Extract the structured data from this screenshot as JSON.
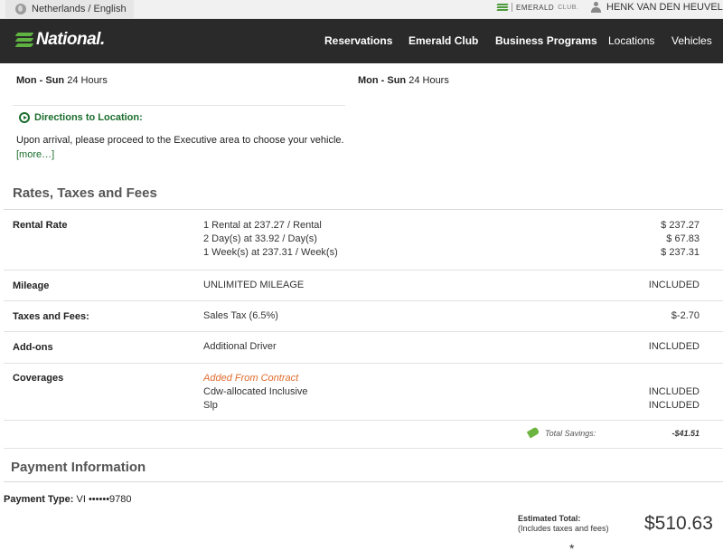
{
  "util_bar": {
    "locale": "Netherlands / English",
    "emerald_brand": "EMERALD",
    "emerald_club": "CLUB.",
    "user_name": "HENK VAN DEN HEUVEL"
  },
  "nav": {
    "logo": "National.",
    "items": [
      "Reservations",
      "Emerald Club",
      "Business Programs",
      "Locations",
      "Vehicles"
    ]
  },
  "hours": [
    {
      "days": "Mon - Sun",
      "time": " 24 Hours"
    },
    {
      "days": "Mon - Sun",
      "time": " 24 Hours"
    }
  ],
  "directions": {
    "title": "Directions to Location:",
    "text": "Upon arrival, please proceed to the Executive area to choose your vehicle.",
    "more": "[more…]"
  },
  "rates": {
    "title": "Rates, Taxes and Fees",
    "rows": [
      {
        "label": "Rental Rate",
        "desc": [
          "1 Rental at 237.27 / Rental",
          "2 Day(s) at 33.92 / Day(s)",
          "1 Week(s) at 237.31 / Week(s)"
        ],
        "amounts": [
          "$ 237.27",
          "$ 67.83",
          "$ 237.31"
        ]
      },
      {
        "label": "Mileage",
        "desc": [
          "UNLIMITED MILEAGE"
        ],
        "amounts": [
          "INCLUDED"
        ]
      },
      {
        "label": "Taxes and Fees:",
        "desc": [
          "Sales Tax (6.5%)"
        ],
        "amounts": [
          "$-2.70"
        ]
      },
      {
        "label": "Add-ons",
        "desc": [
          "Additional Driver"
        ],
        "amounts": [
          "INCLUDED"
        ]
      },
      {
        "label": "Coverages",
        "note": "Added From Contract",
        "desc": [
          "Cdw-allocated Inclusive",
          "Slp"
        ],
        "amounts": [
          "INCLUDED",
          "INCLUDED"
        ]
      }
    ],
    "savings_label": "Total Savings:",
    "savings_amount": "-$41.51"
  },
  "payment": {
    "title": "Payment Information",
    "type_label": "Payment Type:",
    "type_value": " VI ••••••9780",
    "estimated_label": "Estimated Total:",
    "estimated_note": "(Includes taxes and fees)",
    "estimated_total": "$510.63",
    "asterisk": "*"
  },
  "colors": {
    "nav_bg": "#2a2a2a",
    "brand_green": "#5fb341",
    "link_green": "#1b6e2e",
    "accent_orange": "#e06b2d"
  }
}
